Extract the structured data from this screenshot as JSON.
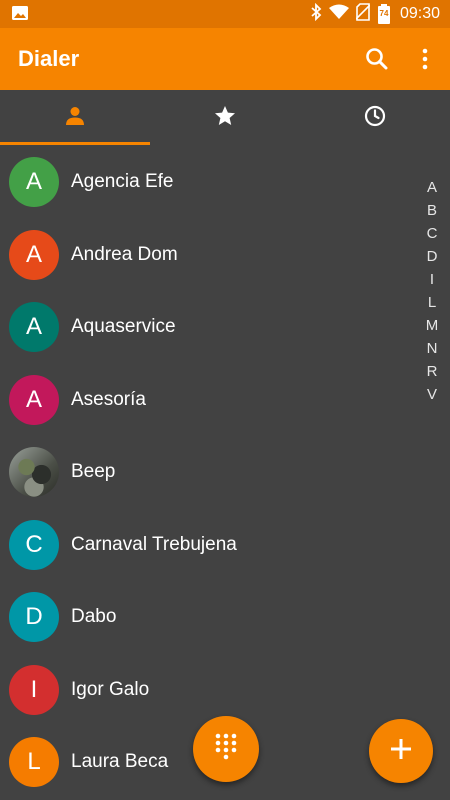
{
  "status_bar": {
    "time": "09:30",
    "battery_level": "74",
    "icons": [
      "gallery-icon",
      "bluetooth-icon",
      "wifi-icon",
      "no-sim-icon",
      "battery-icon"
    ]
  },
  "app_bar": {
    "title": "Dialer",
    "color": "#F68400",
    "actions": [
      "search-icon",
      "more-vert-icon"
    ]
  },
  "tabs": [
    {
      "icon": "person-icon",
      "name": "contacts",
      "selected": true
    },
    {
      "icon": "star-icon",
      "name": "favorites",
      "selected": false
    },
    {
      "icon": "clock-icon",
      "name": "recents",
      "selected": false
    }
  ],
  "contacts": [
    {
      "initial": "A",
      "name": "Agencia Efe",
      "color": "#43A047"
    },
    {
      "initial": "A",
      "name": "Andrea Dom",
      "color": "#E64A19"
    },
    {
      "initial": "A",
      "name": "Aquaservice",
      "color": "#00796B"
    },
    {
      "initial": "A",
      "name": "Asesoría",
      "color": "#C2185B"
    },
    {
      "initial": "",
      "name": "Beep",
      "color": "photo"
    },
    {
      "initial": "C",
      "name": "Carnaval Trebujena",
      "color": "#0097A7"
    },
    {
      "initial": "D",
      "name": "Dabo",
      "color": "#0097A7"
    },
    {
      "initial": "I",
      "name": "Igor Galo",
      "color": "#D32F2F"
    },
    {
      "initial": "L",
      "name": "Laura Beca",
      "color": "#F57C00"
    }
  ],
  "index_letters": [
    "A",
    "B",
    "C",
    "D",
    "I",
    "L",
    "M",
    "N",
    "R",
    "V"
  ],
  "fabs": [
    {
      "name": "dialpad",
      "icon": "dialpad-icon"
    },
    {
      "name": "add-contact",
      "icon": "plus-icon"
    }
  ]
}
